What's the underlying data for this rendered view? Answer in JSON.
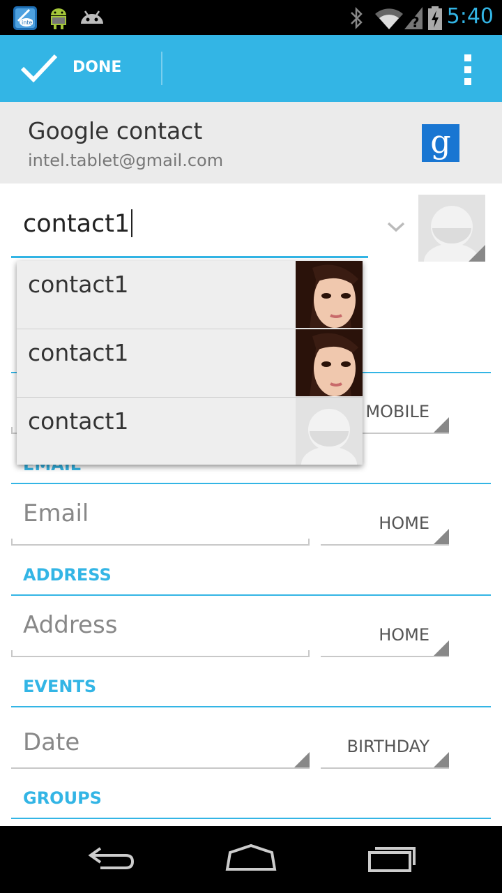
{
  "status_bar": {
    "time": "5:40",
    "icons": [
      "intel-app-icon",
      "android-debug-icon",
      "android-icon",
      "bluetooth-icon",
      "wifi-icon",
      "signal-icon",
      "battery-charging-icon"
    ]
  },
  "action_bar": {
    "done_label": "DONE",
    "overflow_icon": "more-vert-icon"
  },
  "account": {
    "type": "Google contact",
    "email": "intel.tablet@gmail.com",
    "logo_letter": "g"
  },
  "name": {
    "value": "contact1"
  },
  "suggestions": [
    {
      "name": "contact1",
      "photo": "woman-photo"
    },
    {
      "name": "contact1",
      "photo": "woman-photo"
    },
    {
      "name": "contact1",
      "photo": "default-avatar"
    }
  ],
  "phone": {
    "type": "MOBILE"
  },
  "email": {
    "section_title": "EMAIL",
    "placeholder": "Email",
    "type": "HOME"
  },
  "address": {
    "section_title": "ADDRESS",
    "placeholder": "Address",
    "type": "HOME"
  },
  "events": {
    "section_title": "EVENTS",
    "placeholder": "Date",
    "type": "BIRTHDAY"
  },
  "groups": {
    "section_title": "GROUPS"
  },
  "nav_bar": {
    "buttons": [
      "back-icon",
      "home-icon",
      "recent-apps-icon"
    ]
  },
  "colors": {
    "accent": "#33b5e5",
    "status_bar": "#000000",
    "account_header": "#ebebeb"
  }
}
